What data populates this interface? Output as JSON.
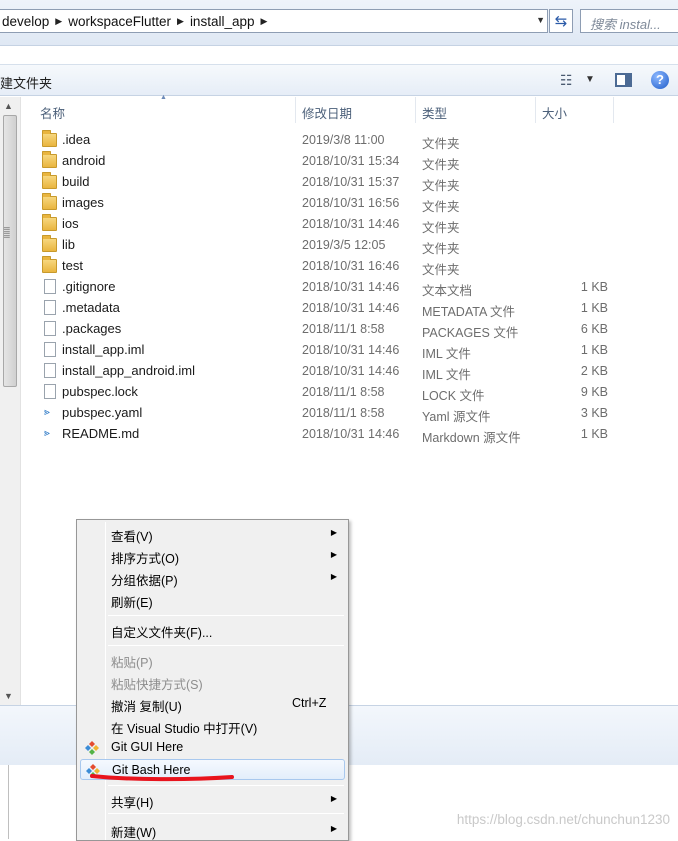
{
  "address_bar": {
    "crumbs": [
      "develop",
      "workspaceFlutter",
      "install_app"
    ],
    "search_placeholder": "搜索 instal..."
  },
  "toolbar": {
    "new_folder_label": "建文件夹"
  },
  "columns": {
    "name": "名称",
    "date": "修改日期",
    "type": "类型",
    "size": "大小"
  },
  "files": [
    {
      "name": ".idea",
      "date": "2019/3/8 11:00",
      "type": "文件夹",
      "size": "",
      "icon": "folder-icon"
    },
    {
      "name": "android",
      "date": "2018/10/31 15:34",
      "type": "文件夹",
      "size": "",
      "icon": "folder-icon"
    },
    {
      "name": "build",
      "date": "2018/10/31 15:37",
      "type": "文件夹",
      "size": "",
      "icon": "folder-icon"
    },
    {
      "name": "images",
      "date": "2018/10/31 16:56",
      "type": "文件夹",
      "size": "",
      "icon": "folder-icon"
    },
    {
      "name": "ios",
      "date": "2018/10/31 14:46",
      "type": "文件夹",
      "size": "",
      "icon": "folder-icon"
    },
    {
      "name": "lib",
      "date": "2019/3/5 12:05",
      "type": "文件夹",
      "size": "",
      "icon": "folder-icon"
    },
    {
      "name": "test",
      "date": "2018/10/31 16:46",
      "type": "文件夹",
      "size": "",
      "icon": "folder-icon"
    },
    {
      "name": ".gitignore",
      "date": "2018/10/31 14:46",
      "type": "文本文档",
      "size": "1 KB",
      "icon": "text-file-icon"
    },
    {
      "name": ".metadata",
      "date": "2018/10/31 14:46",
      "type": "METADATA 文件",
      "size": "1 KB",
      "icon": "file-icon"
    },
    {
      "name": ".packages",
      "date": "2018/11/1 8:58",
      "type": "PACKAGES 文件",
      "size": "6 KB",
      "icon": "file-icon"
    },
    {
      "name": "install_app.iml",
      "date": "2018/10/31 14:46",
      "type": "IML 文件",
      "size": "1 KB",
      "icon": "file-icon"
    },
    {
      "name": "install_app_android.iml",
      "date": "2018/10/31 14:46",
      "type": "IML 文件",
      "size": "2 KB",
      "icon": "file-icon"
    },
    {
      "name": "pubspec.lock",
      "date": "2018/11/1 8:58",
      "type": "LOCK 文件",
      "size": "9 KB",
      "icon": "file-icon"
    },
    {
      "name": "pubspec.yaml",
      "date": "2018/11/1 8:58",
      "type": "Yaml 源文件",
      "size": "3 KB",
      "icon": "vscode-file-icon"
    },
    {
      "name": "README.md",
      "date": "2018/10/31 14:46",
      "type": "Markdown 源文件",
      "size": "1 KB",
      "icon": "vscode-file-icon"
    }
  ],
  "context_menu": {
    "view": "查看(V)",
    "sort_by": "排序方式(O)",
    "group_by": "分组依据(P)",
    "refresh": "刷新(E)",
    "customize": "自定义文件夹(F)...",
    "paste": "粘贴(P)",
    "paste_shortcut": "粘贴快捷方式(S)",
    "undo_copy": "撤消 复制(U)",
    "undo_shortcut": "Ctrl+Z",
    "open_in_vs": "在 Visual Studio 中打开(V)",
    "git_gui": "Git GUI Here",
    "git_bash": "Git Bash Here",
    "share": "共享(H)",
    "new": "新建(W)"
  },
  "watermark": "https://blog.csdn.net/chunchun1230",
  "colors": {
    "annotation_underline": "#e8141e",
    "folder": "#e9b53f",
    "menu_hover": "#e3eefb"
  }
}
